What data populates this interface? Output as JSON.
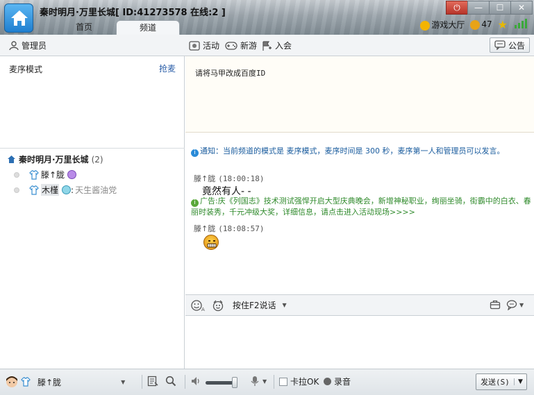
{
  "window": {
    "title": "秦时明月·万里长城[ ID:41273578 在线:2 ]",
    "tabs": [
      {
        "label": "首页"
      },
      {
        "label": "频道"
      }
    ],
    "game_hall": "游戏大厅",
    "coins": "47"
  },
  "toolbar": {
    "admin": "管理员",
    "activity": "活动",
    "new_tour": "新游",
    "join": "入会",
    "notice": "公告"
  },
  "left_panel": {
    "mic_mode": "麦序模式",
    "grab_mic": "抢麦",
    "channel_name": "秦时明月·万里长城",
    "channel_count": "(2)",
    "members": [
      {
        "name": "滕↑胧",
        "suffix": ""
      },
      {
        "name": "木槿",
        "suffix": "天生酱油党"
      }
    ]
  },
  "announcement": {
    "text": "请将马甲改成百度ID"
  },
  "chat": {
    "system_notice": "通知：当前频道的模式是 麦序模式，麦序时间是 300 秒，麦序第一人和管理员可以发言。",
    "messages": [
      {
        "user": "滕↑胧",
        "time": "(18:00:18)",
        "text": "竟然有人- -"
      },
      {
        "user": "滕↑胧",
        "time": "(18:08:57)",
        "text": ""
      }
    ],
    "ad": "广告:庆《列国志》技术测试强悍开启大型庆典晚会，新增神秘职业，绚丽坐骑，街霸中的白衣、春丽时装秀，千元冲级大奖，详细信息，请点击进入活动现场>>>>"
  },
  "input_bar": {
    "ptt": "按住F2说话"
  },
  "bottom_bar": {
    "user": "滕↑胧",
    "karaoke": "卡拉OK",
    "record": "录音",
    "send": "发送(S)"
  }
}
